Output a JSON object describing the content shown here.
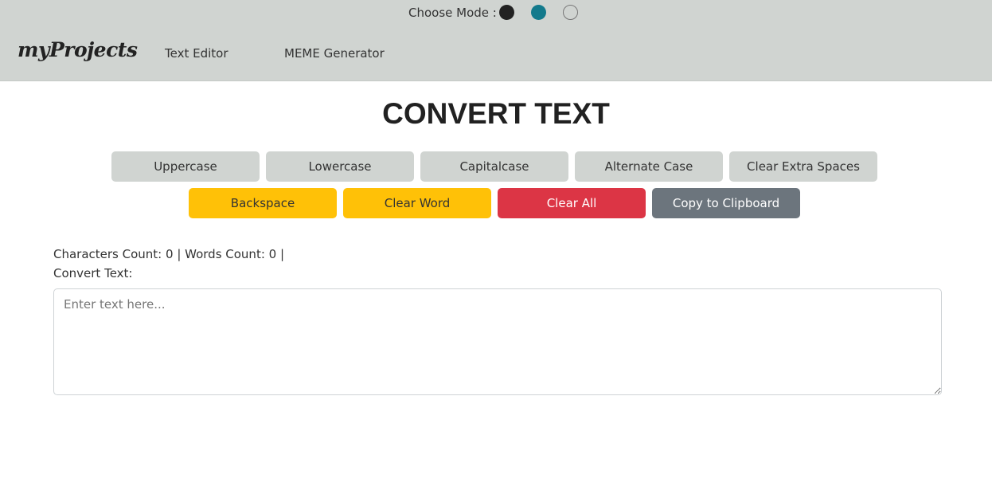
{
  "navbar": {
    "mode_label": "Choose Mode :",
    "modes": [
      {
        "name": "dark",
        "color": "#222222"
      },
      {
        "name": "teal",
        "color": "#137a8c"
      },
      {
        "name": "light",
        "color": "#d0d4d1"
      }
    ],
    "brand": "myProjects",
    "links": [
      "Text Editor",
      "MEME Generator"
    ]
  },
  "main": {
    "title": "CONVERT TEXT",
    "row1_buttons": [
      "Uppercase",
      "Lowercase",
      "Capitalcase",
      "Alternate Case",
      "Clear Extra Spaces"
    ],
    "row2_buttons": [
      "Backspace",
      "Clear Word",
      "Clear All",
      "Copy to Clipboard"
    ],
    "counts_text": "Characters Count: 0 | Words Count: 0 |",
    "convert_label": "Convert Text:",
    "textarea_placeholder": "Enter text here...",
    "textarea_value": ""
  },
  "colors": {
    "navbar_bg": "#d0d4d1",
    "light_button": "#d0d4d1",
    "warning": "#ffc107",
    "danger": "#dc3545",
    "secondary": "#6c757d"
  }
}
